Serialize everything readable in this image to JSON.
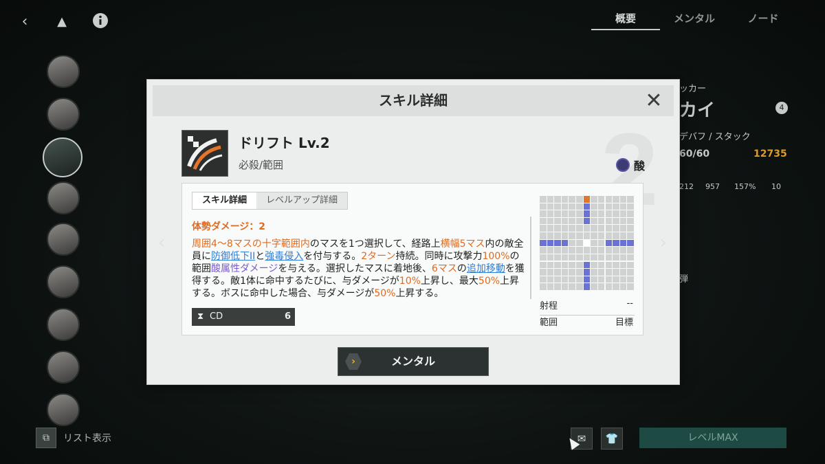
{
  "top_tabs": [
    "概要",
    "メンタル",
    "ノード"
  ],
  "sidebar": {
    "list_view_label": "リスト表示"
  },
  "right_panel": {
    "class_label": "ッカー",
    "name": "カイ",
    "rank_badge": "4",
    "tags": "デバフ / スタック",
    "hp": "60/60",
    "power": "12735",
    "stats": [
      "212",
      "957",
      "157%",
      "10"
    ],
    "weapon_label": "弾"
  },
  "bottom": {
    "level_max": "レベルMAX"
  },
  "modal": {
    "title": "スキル詳細",
    "big_level_number": "2",
    "skill_name": "ドリフト Lv.2",
    "skill_type": "必殺/範囲",
    "element": "酸",
    "subtabs": [
      "スキル詳細",
      "レベルアップ詳細"
    ],
    "damage_label": "体勢ダメージ：2",
    "cd_label": "CD",
    "cd_value": "6",
    "range_label": "射程",
    "range_value": "--",
    "scope_label": "範囲",
    "scope_value": "目標",
    "action_button": "メンタル",
    "description_segments": [
      {
        "t": "周囲4〜8マスの十字範囲内",
        "c": "or"
      },
      {
        "t": "のマスを1つ選択して、経路上",
        "c": ""
      },
      {
        "t": "横幅5マス",
        "c": "or"
      },
      {
        "t": "内の敵全員に",
        "c": ""
      },
      {
        "t": "防御低下II",
        "c": "link"
      },
      {
        "t": "と",
        "c": ""
      },
      {
        "t": "強毒侵入",
        "c": "link"
      },
      {
        "t": "を付与する。",
        "c": ""
      },
      {
        "t": "2ターン",
        "c": "or"
      },
      {
        "t": "持続。同時に攻撃力",
        "c": ""
      },
      {
        "t": "100%",
        "c": "or"
      },
      {
        "t": "の範囲",
        "c": ""
      },
      {
        "t": "酸属性ダメージ",
        "c": "pu"
      },
      {
        "t": "を与える。選択したマスに着地後、",
        "c": ""
      },
      {
        "t": "6マス",
        "c": "or"
      },
      {
        "t": "の",
        "c": ""
      },
      {
        "t": "追加移動",
        "c": "link"
      },
      {
        "t": "を獲得する。敵1体に命中するたびに、与ダメージが",
        "c": ""
      },
      {
        "t": "10%",
        "c": "or"
      },
      {
        "t": "上昇し、最大",
        "c": ""
      },
      {
        "t": "50%",
        "c": "or"
      },
      {
        "t": "上昇する。ボスに命中した場合、与ダメージが",
        "c": ""
      },
      {
        "t": "50%",
        "c": "or"
      },
      {
        "t": "上昇する。",
        "c": ""
      }
    ],
    "range_grid": {
      "size": 13,
      "colors": {
        "empty": "#cfd2d1",
        "target": "#6a72d6",
        "origin": "#ffffff",
        "self": "#e0782a"
      },
      "self_cell": [
        0,
        6
      ],
      "origin_cell": [
        6,
        6
      ],
      "target_cells": [
        [
          1,
          6
        ],
        [
          2,
          6
        ],
        [
          3,
          6
        ],
        [
          9,
          6
        ],
        [
          10,
          6
        ],
        [
          11,
          6
        ],
        [
          12,
          6
        ],
        [
          6,
          0
        ],
        [
          6,
          1
        ],
        [
          6,
          2
        ],
        [
          6,
          3
        ],
        [
          6,
          9
        ],
        [
          6,
          10
        ],
        [
          6,
          11
        ],
        [
          6,
          12
        ]
      ]
    }
  }
}
